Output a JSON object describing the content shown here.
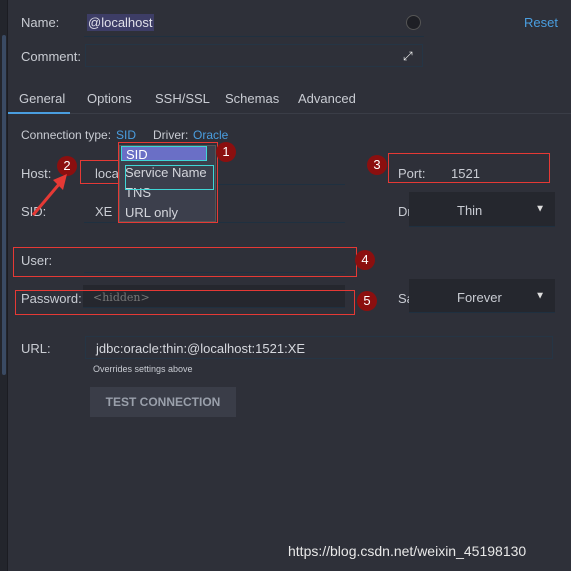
{
  "name": {
    "label": "Name:",
    "value": "@localhost",
    "reset": "Reset"
  },
  "comment": {
    "label": "Comment:"
  },
  "tabs": [
    "General",
    "Options",
    "SSH/SSL",
    "Schemas",
    "Advanced"
  ],
  "conn": {
    "type_label": "Connection type:",
    "type_value": "SID",
    "driver_label": "Driver:",
    "driver_value": "Oracle"
  },
  "host": {
    "label": "Host:",
    "value": "loca"
  },
  "port": {
    "label": "Port:",
    "value": "1521"
  },
  "sid": {
    "label": "SID:",
    "value": "XE"
  },
  "driver": {
    "label": "Driver:",
    "value": "Thin"
  },
  "popup": {
    "items": [
      "SID",
      "Service Name",
      "TNS",
      "URL only"
    ]
  },
  "user": {
    "label": "User:"
  },
  "password": {
    "label": "Password:",
    "placeholder": "<hidden>"
  },
  "save": {
    "label": "Save:",
    "value": "Forever"
  },
  "url": {
    "label": "URL:",
    "value": "jdbc:oracle:thin:@localhost:1521:XE",
    "hint": "Overrides settings above"
  },
  "test_button": "TEST CONNECTION",
  "badges": [
    "1",
    "2",
    "3",
    "4",
    "5"
  ],
  "watermark": "https://blog.csdn.net/weixin_45198130",
  "colors": {
    "accent": "#4a9ee0",
    "highlight": "#6a6fc6",
    "annotation": "#e53935"
  }
}
